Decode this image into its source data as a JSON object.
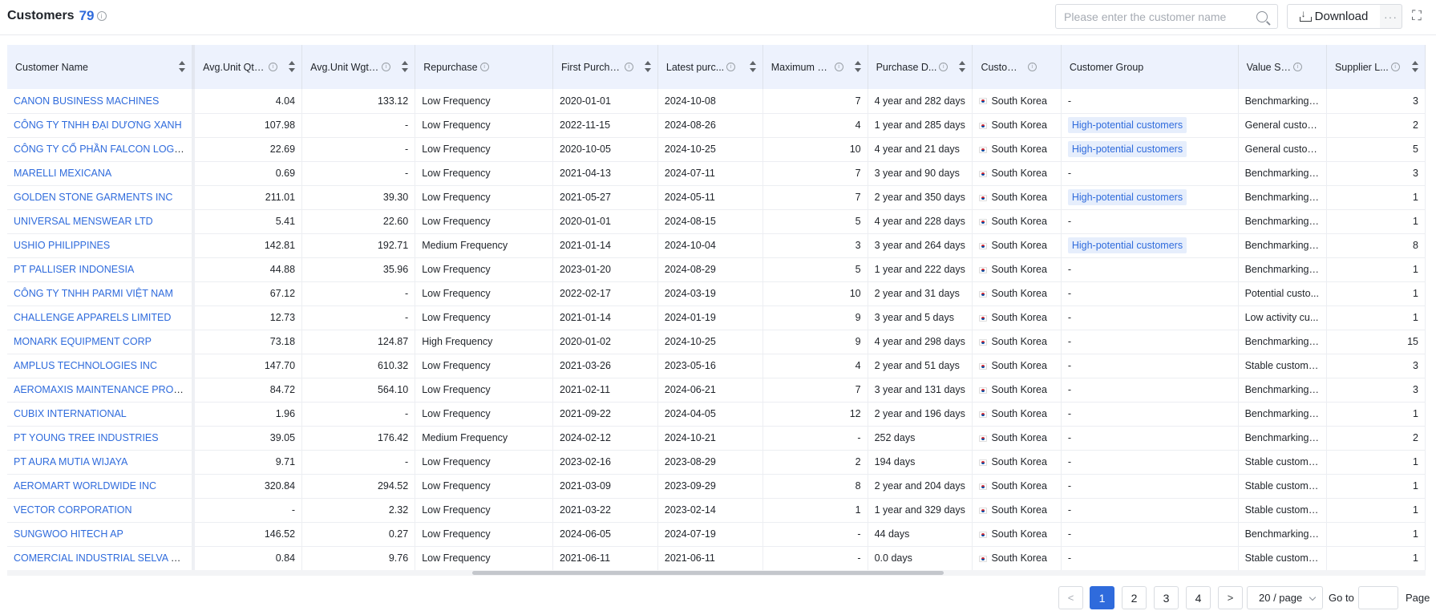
{
  "header": {
    "title": "Customers",
    "count": "79",
    "info_glyph": "i",
    "search_placeholder": "Please enter the customer name",
    "download_label": "Download",
    "more_label": "···",
    "expand_glyph": "⛶"
  },
  "table": {
    "columns": [
      {
        "label": "Customer Name",
        "info": false,
        "sort": true
      },
      {
        "label": "Avg.Unit Qty P...",
        "info": true,
        "sort": true
      },
      {
        "label": "Avg.Unit Wgt ...",
        "info": true,
        "sort": true
      },
      {
        "label": "Repurchase",
        "info": true,
        "sort": false
      },
      {
        "label": "First Purcha...",
        "info": true,
        "sort": true
      },
      {
        "label": "Latest purc...",
        "info": true,
        "sort": true
      },
      {
        "label": "Maximum D...",
        "info": true,
        "sort": true
      },
      {
        "label": "Purchase D...",
        "info": true,
        "sort": true
      },
      {
        "label": "Customer L...",
        "info": true,
        "sort": false
      },
      {
        "label": "Customer Group",
        "info": false,
        "sort": false
      },
      {
        "label": "Value Strat...",
        "info": true,
        "sort": false
      },
      {
        "label": "Supplier L...",
        "info": true,
        "sort": true
      }
    ],
    "rows": [
      [
        "CANON BUSINESS MACHINES",
        "4.04",
        "133.12",
        "Low Frequency",
        "2020-01-01",
        "2024-10-08",
        "7",
        "4 year and 282 days",
        "South Korea",
        "-",
        "Benchmarking ...",
        "3"
      ],
      [
        "CÔNG TY TNHH ĐẠI DƯƠNG XANH",
        "107.98",
        "-",
        "Low Frequency",
        "2022-11-15",
        "2024-08-26",
        "4",
        "1 year and 285 days",
        "South Korea",
        "High-potential customers",
        "General custom...",
        "2"
      ],
      [
        "CÔNG TY CỔ PHẦN FALCON LOGISTICS",
        "22.69",
        "-",
        "Low Frequency",
        "2020-10-05",
        "2024-10-25",
        "10",
        "4 year and 21 days",
        "South Korea",
        "High-potential customers",
        "General custom...",
        "5"
      ],
      [
        "MARELLI MEXICANA",
        "0.69",
        "-",
        "Low Frequency",
        "2021-04-13",
        "2024-07-11",
        "7",
        "3 year and 90 days",
        "South Korea",
        "-",
        "Benchmarking ...",
        "3"
      ],
      [
        "GOLDEN STONE GARMENTS INC",
        "211.01",
        "39.30",
        "Low Frequency",
        "2021-05-27",
        "2024-05-11",
        "7",
        "2 year and 350 days",
        "South Korea",
        "High-potential customers",
        "Benchmarking ...",
        "1"
      ],
      [
        "UNIVERSAL MENSWEAR LTD",
        "5.41",
        "22.60",
        "Low Frequency",
        "2020-01-01",
        "2024-08-15",
        "5",
        "4 year and 228 days",
        "South Korea",
        "-",
        "Benchmarking ...",
        "1"
      ],
      [
        "USHIO PHILIPPINES",
        "142.81",
        "192.71",
        "Medium Frequency",
        "2021-01-14",
        "2024-10-04",
        "3",
        "3 year and 264 days",
        "South Korea",
        "High-potential customers",
        "Benchmarking ...",
        "8"
      ],
      [
        "PT PALLISER INDONESIA",
        "44.88",
        "35.96",
        "Low Frequency",
        "2023-01-20",
        "2024-08-29",
        "5",
        "1 year and 222 days",
        "South Korea",
        "-",
        "Benchmarking ...",
        "1"
      ],
      [
        "CÔNG TY TNHH PARMI VIỆT NAM",
        "67.12",
        "-",
        "Low Frequency",
        "2022-02-17",
        "2024-03-19",
        "10",
        "2 year and 31 days",
        "South Korea",
        "-",
        "Potential custo...",
        "1"
      ],
      [
        "CHALLENGE APPARELS LIMITED",
        "12.73",
        "-",
        "Low Frequency",
        "2021-01-14",
        "2024-01-19",
        "9",
        "3 year and 5 days",
        "South Korea",
        "-",
        "Low activity cu...",
        "1"
      ],
      [
        "MONARK EQUIPMENT CORP",
        "73.18",
        "124.87",
        "High Frequency",
        "2020-01-02",
        "2024-10-25",
        "9",
        "4 year and 298 days",
        "South Korea",
        "-",
        "Benchmarking ...",
        "15"
      ],
      [
        "AMPLUS TECHNOLOGIES INC",
        "147.70",
        "610.32",
        "Low Frequency",
        "2021-03-26",
        "2023-05-16",
        "4",
        "2 year and 51 days",
        "South Korea",
        "-",
        "Stable customers",
        "3"
      ],
      [
        "AEROMAXIS MAINTENANCE PRODUC...",
        "84.72",
        "564.10",
        "Low Frequency",
        "2021-02-11",
        "2024-06-21",
        "7",
        "3 year and 131 days",
        "South Korea",
        "-",
        "Benchmarking ...",
        "3"
      ],
      [
        "CUBIX INTERNATIONAL",
        "1.96",
        "-",
        "Low Frequency",
        "2021-09-22",
        "2024-04-05",
        "12",
        "2 year and 196 days",
        "South Korea",
        "-",
        "Benchmarking ...",
        "1"
      ],
      [
        "PT YOUNG TREE INDUSTRIES",
        "39.05",
        "176.42",
        "Medium Frequency",
        "2024-02-12",
        "2024-10-21",
        "-",
        "252 days",
        "South Korea",
        "-",
        "Benchmarking ...",
        "2"
      ],
      [
        "PT AURA MUTIA WIJAYA",
        "9.71",
        "-",
        "Low Frequency",
        "2023-02-16",
        "2023-08-29",
        "2",
        "194 days",
        "South Korea",
        "-",
        "Stable customers",
        "1"
      ],
      [
        "AEROMART WORLDWIDE INC",
        "320.84",
        "294.52",
        "Low Frequency",
        "2021-03-09",
        "2023-09-29",
        "8",
        "2 year and 204 days",
        "South Korea",
        "-",
        "Stable customers",
        "1"
      ],
      [
        "VECTOR CORPORATION",
        "-",
        "2.32",
        "Low Frequency",
        "2021-03-22",
        "2023-02-14",
        "1",
        "1 year and 329 days",
        "South Korea",
        "-",
        "Stable customers",
        "1"
      ],
      [
        "SUNGWOO HITECH AP",
        "146.52",
        "0.27",
        "Low Frequency",
        "2024-06-05",
        "2024-07-19",
        "-",
        "44 days",
        "South Korea",
        "-",
        "Benchmarking ...",
        "1"
      ],
      [
        "COMERCIAL INDUSTRIAL SELVA S A",
        "0.84",
        "9.76",
        "Low Frequency",
        "2021-06-11",
        "2021-06-11",
        "-",
        "0.0 days",
        "South Korea",
        "-",
        "Stable customers",
        "1"
      ]
    ]
  },
  "pagination": {
    "prev_glyph": "<",
    "next_glyph": ">",
    "pages": [
      "1",
      "2",
      "3",
      "4"
    ],
    "active_page": "1",
    "page_size": "20 / page",
    "goto_label": "Go to",
    "page_label": "Page"
  },
  "colors": {
    "accent": "#2f6bdc",
    "header_bg": "#edf2fd",
    "tag_bg": "#e6eefc"
  }
}
